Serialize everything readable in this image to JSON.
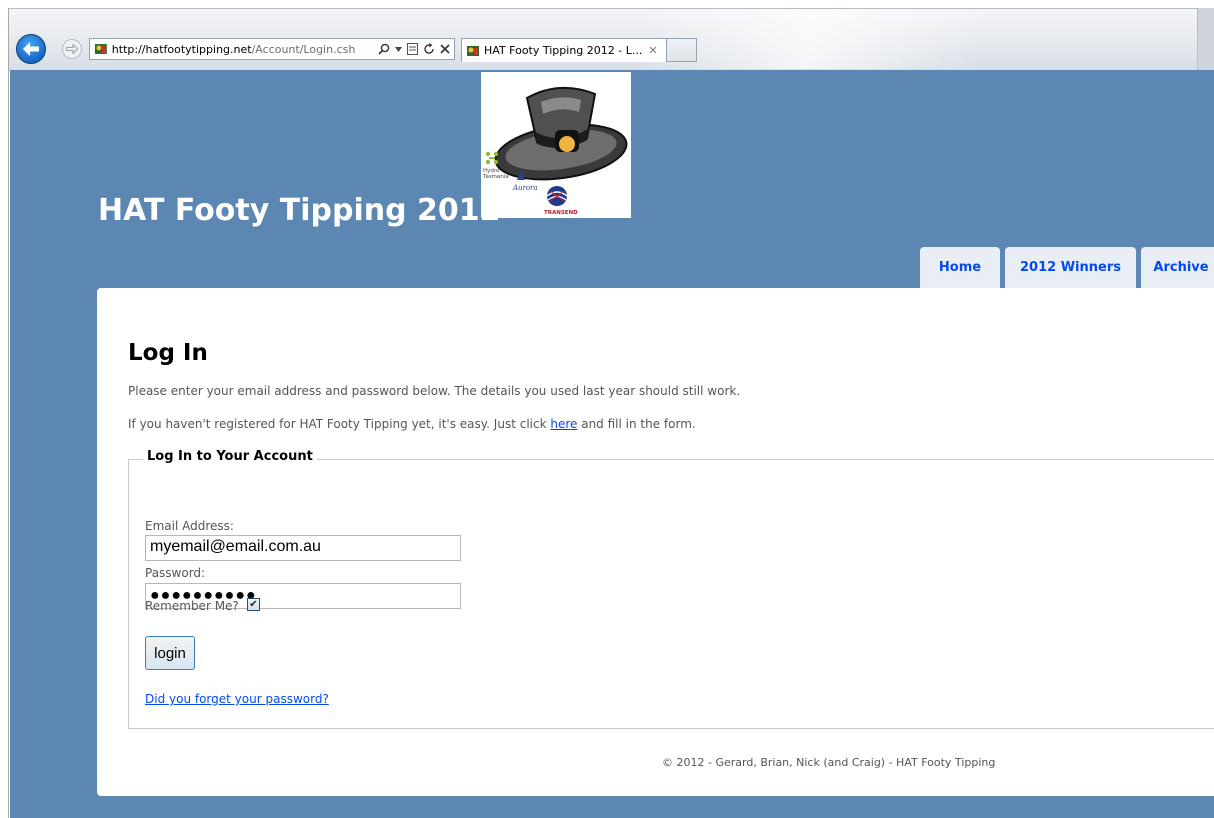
{
  "browser": {
    "address": {
      "host": "http://hatfootytipping.net",
      "path": "/Account/Login.csh"
    },
    "tab_title": "HAT Footy Tipping 2012 - L..."
  },
  "header": {
    "title": "HAT Footy Tipping 2012"
  },
  "logo": {
    "brands": [
      "Hydro",
      "Tasmania",
      "Aurora",
      "TRANSEND"
    ]
  },
  "menu": [
    {
      "label": "Home"
    },
    {
      "label": "2012 Winners"
    },
    {
      "label": "Archive"
    }
  ],
  "main": {
    "heading": "Log In",
    "intro": "Please enter your email address and password below. The details you used last year should still work.",
    "register_prefix": "If you haven't registered for HAT Footy Tipping yet, it's easy. Just click ",
    "register_link": "here",
    "register_suffix": " and fill in the form."
  },
  "form": {
    "legend": "Log In to Your Account",
    "email_label": "Email Address:",
    "email_value": "myemail@email.com.au",
    "password_label": "Password:",
    "password_value": "●●●●●●●●●●",
    "remember_label": "Remember Me?",
    "remember_checked": true,
    "submit_label": "login",
    "forgot_link": "Did you forget your password?"
  },
  "footer": {
    "text": "© 2012 - Gerard, Brian, Nick (and Craig) - HAT Footy Tipping"
  },
  "colors": {
    "page_bg": "#5c87b2",
    "link": "#034af3",
    "tab_bg": "#e8eef4"
  },
  "icons": [
    "back-arrow-icon",
    "forward-arrow-icon",
    "site-favicon-icon",
    "search-icon",
    "dropdown-icon",
    "compatibility-icon",
    "refresh-icon",
    "stop-icon",
    "tab-close-icon",
    "checkmark-icon"
  ]
}
